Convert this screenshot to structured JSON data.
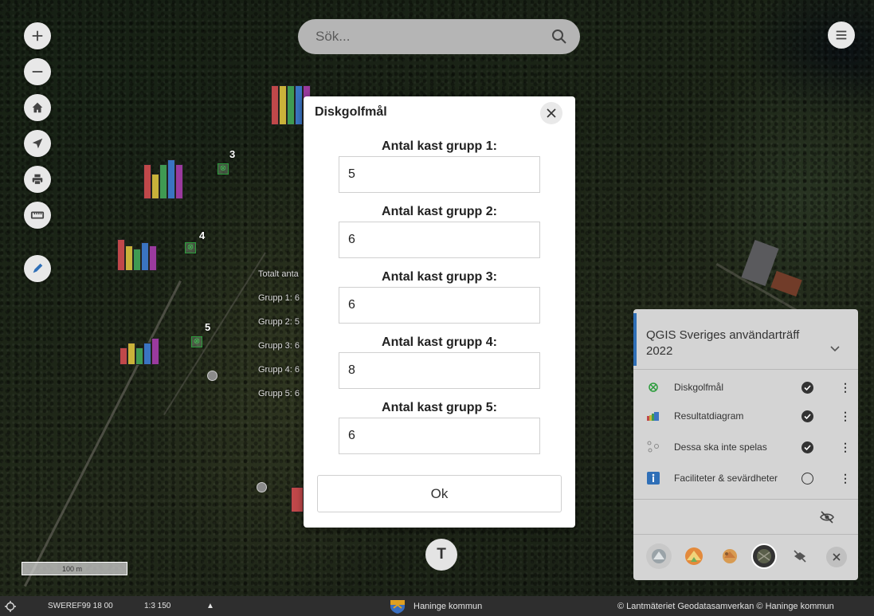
{
  "search": {
    "placeholder": "Sök..."
  },
  "map_controls": [
    {
      "name": "zoom-in-icon"
    },
    {
      "name": "zoom-out-icon"
    },
    {
      "name": "home-icon"
    },
    {
      "name": "locate-icon"
    },
    {
      "name": "print-icon"
    },
    {
      "name": "measure-icon"
    },
    {
      "name": "draw-icon"
    }
  ],
  "map_labels": {
    "hole_numbers": [
      "3",
      "4",
      "5"
    ],
    "result_labels": [
      "Totalt anta",
      "Grupp 1: 6",
      "Grupp 2: 5",
      "Grupp 3: 6",
      "Grupp 4: 6",
      "Grupp 5: 6"
    ]
  },
  "bar_colors": [
    "#c0484a",
    "#c9b23a",
    "#3f9a52",
    "#3a74c2",
    "#9a3a9e"
  ],
  "modal": {
    "title": "Diskgolfmål",
    "fields": [
      {
        "label": "Antal kast grupp 1:",
        "value": "5"
      },
      {
        "label": "Antal kast grupp 2:",
        "value": "6"
      },
      {
        "label": "Antal kast grupp 3:",
        "value": "6"
      },
      {
        "label": "Antal kast grupp 4:",
        "value": "8"
      },
      {
        "label": "Antal kast grupp 5:",
        "value": "6"
      }
    ],
    "ok_label": "Ok"
  },
  "text_tool": {
    "label": "T"
  },
  "layer_panel": {
    "title": "QGIS Sveriges användarträff 2022",
    "layers": [
      {
        "name": "Diskgolfmål",
        "icon": "disc-golf-target-icon",
        "visible": true
      },
      {
        "name": "Resultatdiagram",
        "icon": "bar-chart-icon",
        "visible": true
      },
      {
        "name": "Dessa ska inte spelas",
        "icon": "inactive-targets-icon",
        "visible": true
      },
      {
        "name": "Faciliteter & sevärdheter",
        "icon": "info-icon",
        "visible": false
      }
    ]
  },
  "scale_bar": {
    "label": "100 m"
  },
  "status_bar": {
    "projection": "SWEREF99 18 00",
    "scale": "1:3 150",
    "municipality": "Haninge kommun",
    "attribution": "© Lantmäteriet Geodatasamverkan © Haninge kommun"
  },
  "colors": {
    "accent": "#2f6fb7",
    "checked": "#333333"
  }
}
